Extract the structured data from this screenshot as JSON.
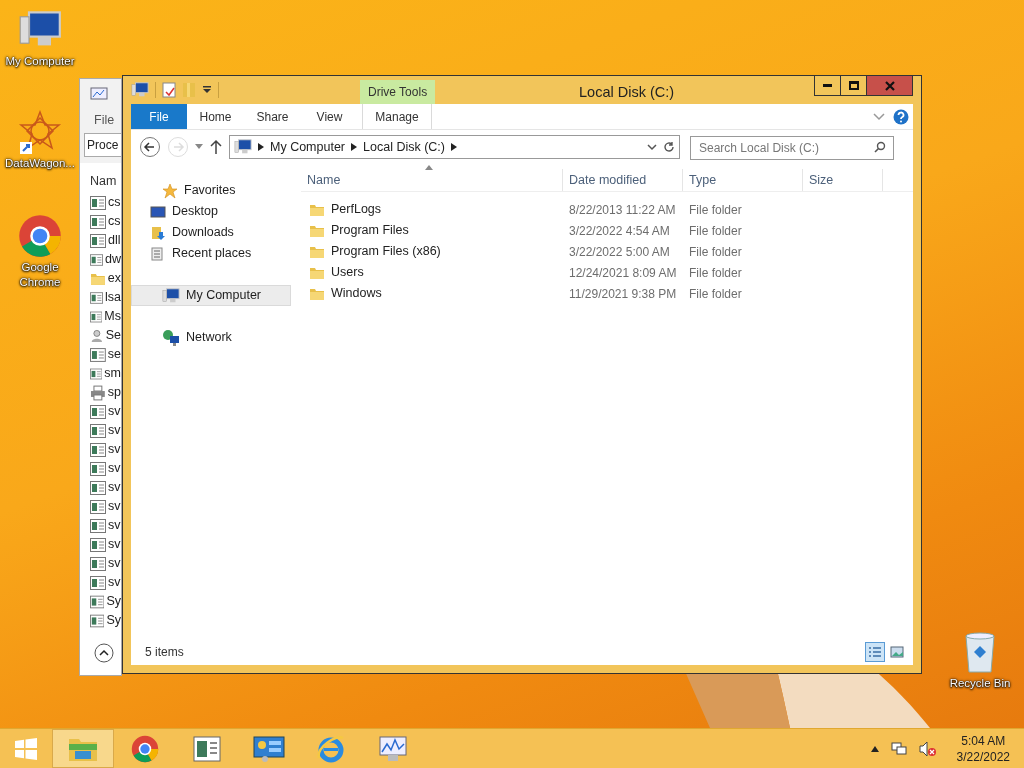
{
  "desktop_icons": [
    {
      "label": "My Computer",
      "kind": "computer"
    },
    {
      "label": "DataWagon...",
      "kind": "app"
    },
    {
      "label": "Google Chrome",
      "kind": "chrome"
    },
    {
      "label": "Recycle Bin",
      "kind": "recycle"
    }
  ],
  "back_window": {
    "menu": "File",
    "tab": "Proce",
    "column": "Nam",
    "rows": [
      {
        "name": "cs",
        "kind": "service"
      },
      {
        "name": "cs",
        "kind": "service"
      },
      {
        "name": "dll",
        "kind": "service"
      },
      {
        "name": "dw",
        "kind": "service"
      },
      {
        "name": "ex",
        "kind": "folder"
      },
      {
        "name": "lsa",
        "kind": "service"
      },
      {
        "name": "Ms",
        "kind": "service"
      },
      {
        "name": "Se",
        "kind": "user"
      },
      {
        "name": "se",
        "kind": "service"
      },
      {
        "name": "sm",
        "kind": "service"
      },
      {
        "name": "sp",
        "kind": "printer"
      },
      {
        "name": "sv",
        "kind": "service"
      },
      {
        "name": "sv",
        "kind": "service"
      },
      {
        "name": "sv",
        "kind": "service"
      },
      {
        "name": "sv",
        "kind": "service"
      },
      {
        "name": "sv",
        "kind": "service"
      },
      {
        "name": "sv",
        "kind": "service"
      },
      {
        "name": "sv",
        "kind": "service"
      },
      {
        "name": "sv",
        "kind": "service"
      },
      {
        "name": "sv",
        "kind": "service"
      },
      {
        "name": "sv",
        "kind": "service"
      },
      {
        "name": "Sy",
        "kind": "service"
      },
      {
        "name": "Sy",
        "kind": "service"
      }
    ]
  },
  "explorer": {
    "title": "Local Disk (C:)",
    "context_group": "Drive Tools",
    "ribbon_tabs": [
      {
        "label": "File",
        "kind": "file"
      },
      {
        "label": "Home",
        "kind": "normal"
      },
      {
        "label": "Share",
        "kind": "normal"
      },
      {
        "label": "View",
        "kind": "normal"
      },
      {
        "label": "Manage",
        "kind": "contextual"
      }
    ],
    "breadcrumb": [
      "My Computer",
      "Local Disk (C:)"
    ],
    "search": {
      "placeholder": "Search Local Disk (C:)"
    },
    "nav": [
      {
        "label": "Favorites",
        "kind": "star",
        "selected": false,
        "children": [
          {
            "label": "Desktop",
            "kind": "desktop",
            "selected": false
          },
          {
            "label": "Downloads",
            "kind": "downloads",
            "selected": false
          },
          {
            "label": "Recent places",
            "kind": "recent",
            "selected": false
          }
        ]
      },
      {
        "label": "My Computer",
        "kind": "computer",
        "selected": true
      },
      {
        "label": "Network",
        "kind": "network",
        "selected": false
      }
    ],
    "columns": [
      "Name",
      "Date modified",
      "Type",
      "Size"
    ],
    "rows": [
      {
        "name": "PerfLogs",
        "date": "8/22/2013 11:22 AM",
        "type": "File folder"
      },
      {
        "name": "Program Files",
        "date": "3/22/2022 4:54 AM",
        "type": "File folder"
      },
      {
        "name": "Program Files (x86)",
        "date": "3/22/2022 5:00 AM",
        "type": "File folder"
      },
      {
        "name": "Users",
        "date": "12/24/2021 8:09 AM",
        "type": "File folder"
      },
      {
        "name": "Windows",
        "date": "11/29/2021 9:38 PM",
        "type": "File folder"
      }
    ],
    "status": "5 items",
    "view_modes": [
      {
        "kind": "details",
        "selected": true
      },
      {
        "kind": "tiles",
        "selected": false
      }
    ]
  },
  "taskbar": {
    "apps": [
      {
        "kind": "explorer",
        "active": true
      },
      {
        "kind": "chrome",
        "active": false
      },
      {
        "kind": "app",
        "active": false
      },
      {
        "kind": "panel",
        "active": false
      },
      {
        "kind": "ie",
        "active": false
      },
      {
        "kind": "monitor",
        "active": false
      }
    ],
    "time": "5:04 AM",
    "date": "3/22/2022"
  }
}
